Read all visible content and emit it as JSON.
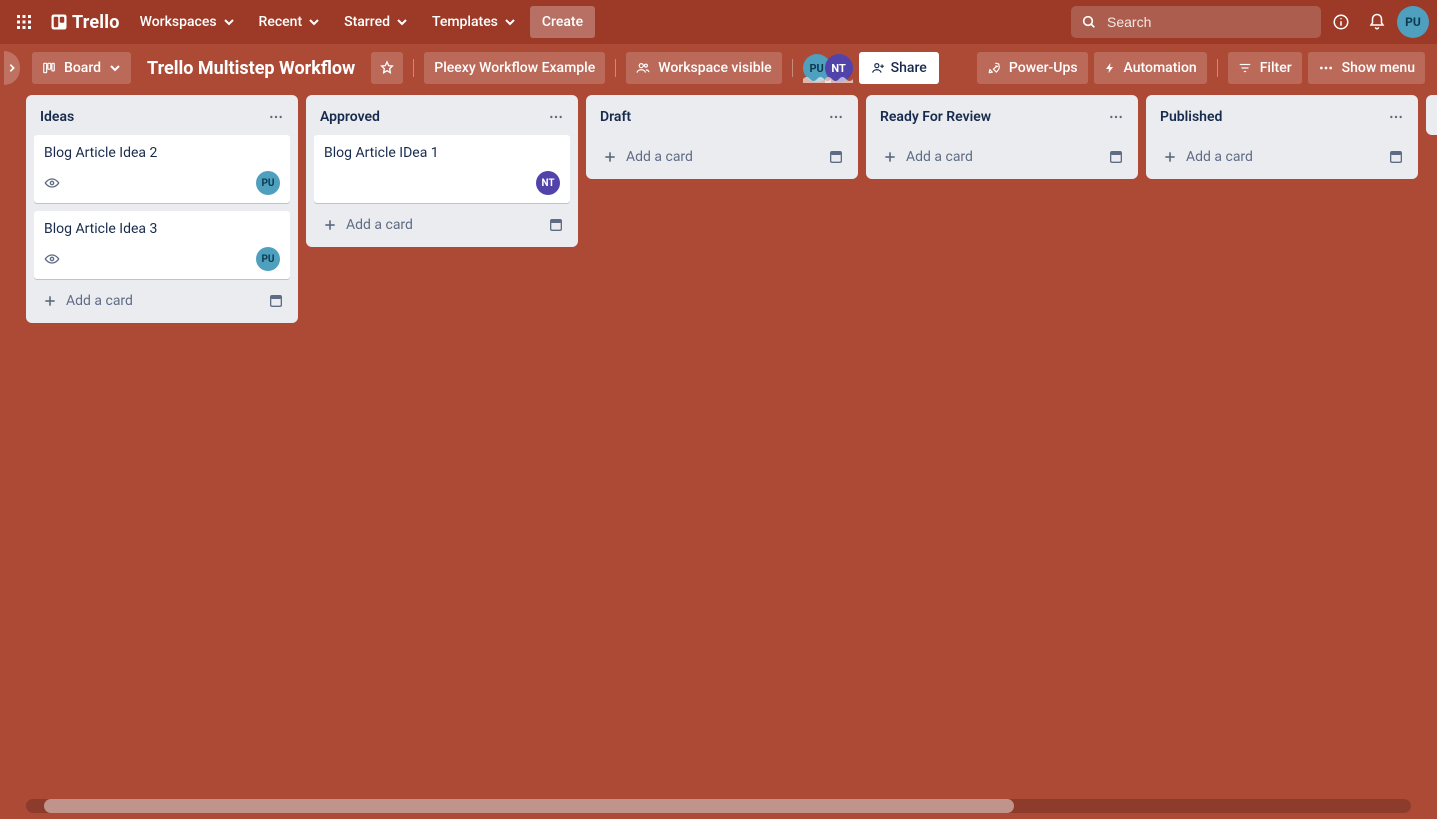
{
  "brand": {
    "name": "Trello"
  },
  "nav": {
    "items": [
      {
        "label": "Workspaces"
      },
      {
        "label": "Recent"
      },
      {
        "label": "Starred"
      },
      {
        "label": "Templates"
      }
    ],
    "create_label": "Create"
  },
  "search": {
    "placeholder": "Search"
  },
  "current_user": {
    "initials": "PU",
    "color": "#4f9fbf"
  },
  "boardbar": {
    "view_label": "Board",
    "title": "Trello Multistep Workflow",
    "workspace_chip": "Pleexy Workflow Example",
    "visibility_label": "Workspace visible",
    "share_label": "Share",
    "powerups_label": "Power-Ups",
    "automation_label": "Automation",
    "filter_label": "Filter",
    "show_menu_label": "Show menu",
    "members": [
      {
        "initials": "PU",
        "color": "#4f9fbf"
      },
      {
        "initials": "NT",
        "color": "#5243aa"
      }
    ]
  },
  "lists": [
    {
      "title": "Ideas",
      "add_label": "Add a card",
      "cards": [
        {
          "title": "Blog Article Idea 2",
          "watching": true,
          "members": [
            {
              "initials": "PU",
              "color": "#4f9fbf"
            }
          ]
        },
        {
          "title": "Blog Article Idea 3",
          "watching": true,
          "members": [
            {
              "initials": "PU",
              "color": "#4f9fbf"
            }
          ]
        }
      ]
    },
    {
      "title": "Approved",
      "add_label": "Add a card",
      "cards": [
        {
          "title": "Blog Article IDea 1",
          "watching": false,
          "members": [
            {
              "initials": "NT",
              "color": "#5243aa"
            }
          ]
        }
      ]
    },
    {
      "title": "Draft",
      "add_label": "Add a card",
      "cards": []
    },
    {
      "title": "Ready For Review",
      "add_label": "Add a card",
      "cards": []
    },
    {
      "title": "Published",
      "add_label": "Add a card",
      "cards": []
    }
  ]
}
